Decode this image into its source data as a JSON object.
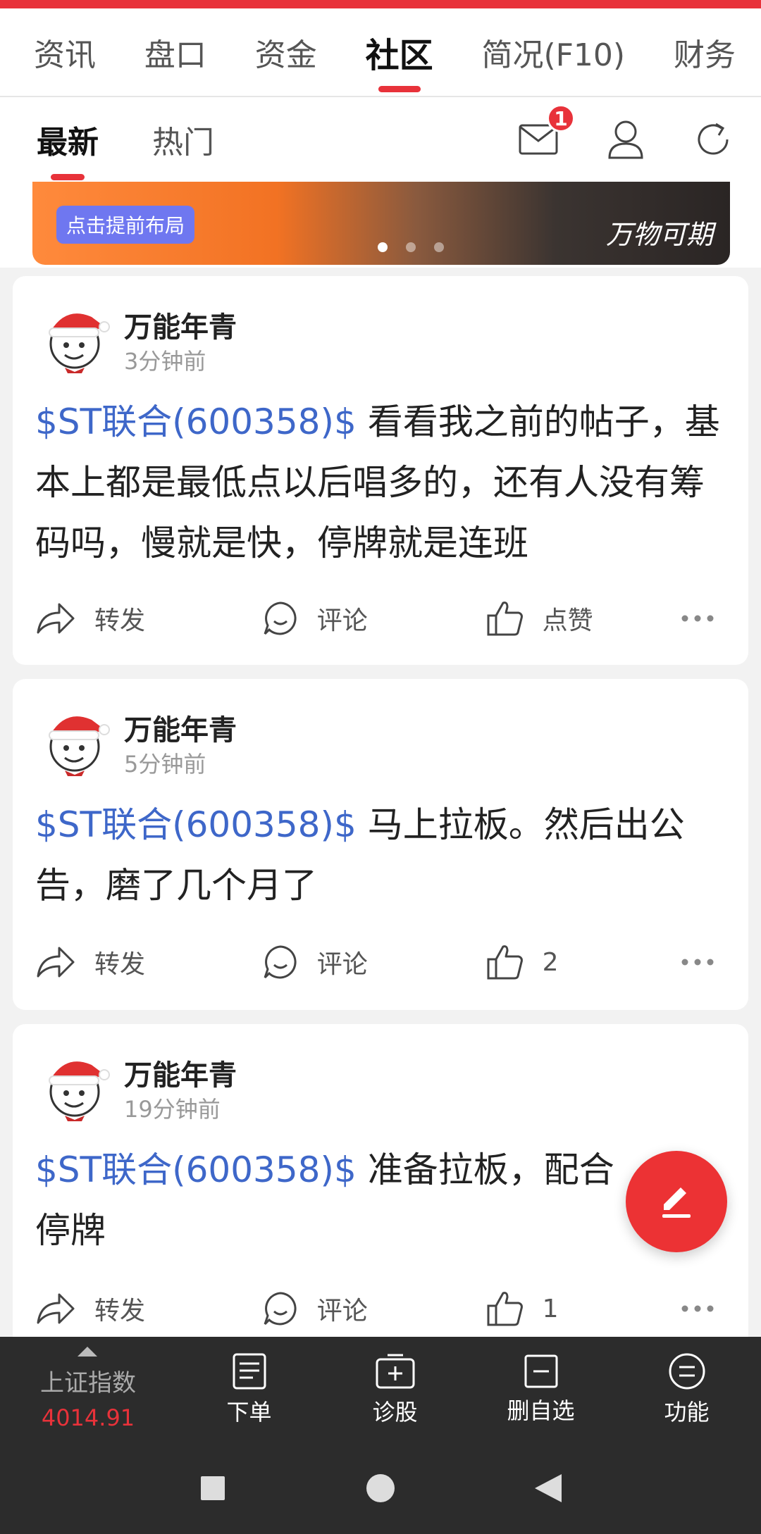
{
  "main_tabs": [
    "资讯",
    "盘口",
    "资金",
    "社区",
    "简况(F10)",
    "财务"
  ],
  "main_tab_active": "社区",
  "sub_tabs": [
    "最新",
    "热门"
  ],
  "notification_count": "1",
  "banner": {
    "cta": "点击提前布局",
    "brand": "万物可期"
  },
  "posts": [
    {
      "author": "万能年青",
      "time": "3分钟前",
      "stock": "$ST联合(600358)$",
      "text": " 看看我之前的帖子，基本上都是最低点以后唱多的，还有人没有筹码吗，慢就是快，停牌就是连班",
      "share": "转发",
      "comment": "评论",
      "like": "点赞"
    },
    {
      "author": "万能年青",
      "time": "5分钟前",
      "stock": "$ST联合(600358)$",
      "text": " 马上拉板。然后出公告，磨了几个月了",
      "share": "转发",
      "comment": "评论",
      "like": "2"
    },
    {
      "author": "万能年青",
      "time": "19分钟前",
      "stock": "$ST联合(600358)$",
      "text": " 准备拉板，配合",
      "text2": "停牌",
      "share": "转发",
      "comment": "评论",
      "like": "1"
    }
  ],
  "bottom_bar": {
    "index_name": "上证指数",
    "index_value": "4014.91",
    "items": [
      "下单",
      "诊股",
      "删自选",
      "功能"
    ]
  },
  "colors": {
    "accent": "#e8323a",
    "stock_link": "#3e67c9"
  }
}
